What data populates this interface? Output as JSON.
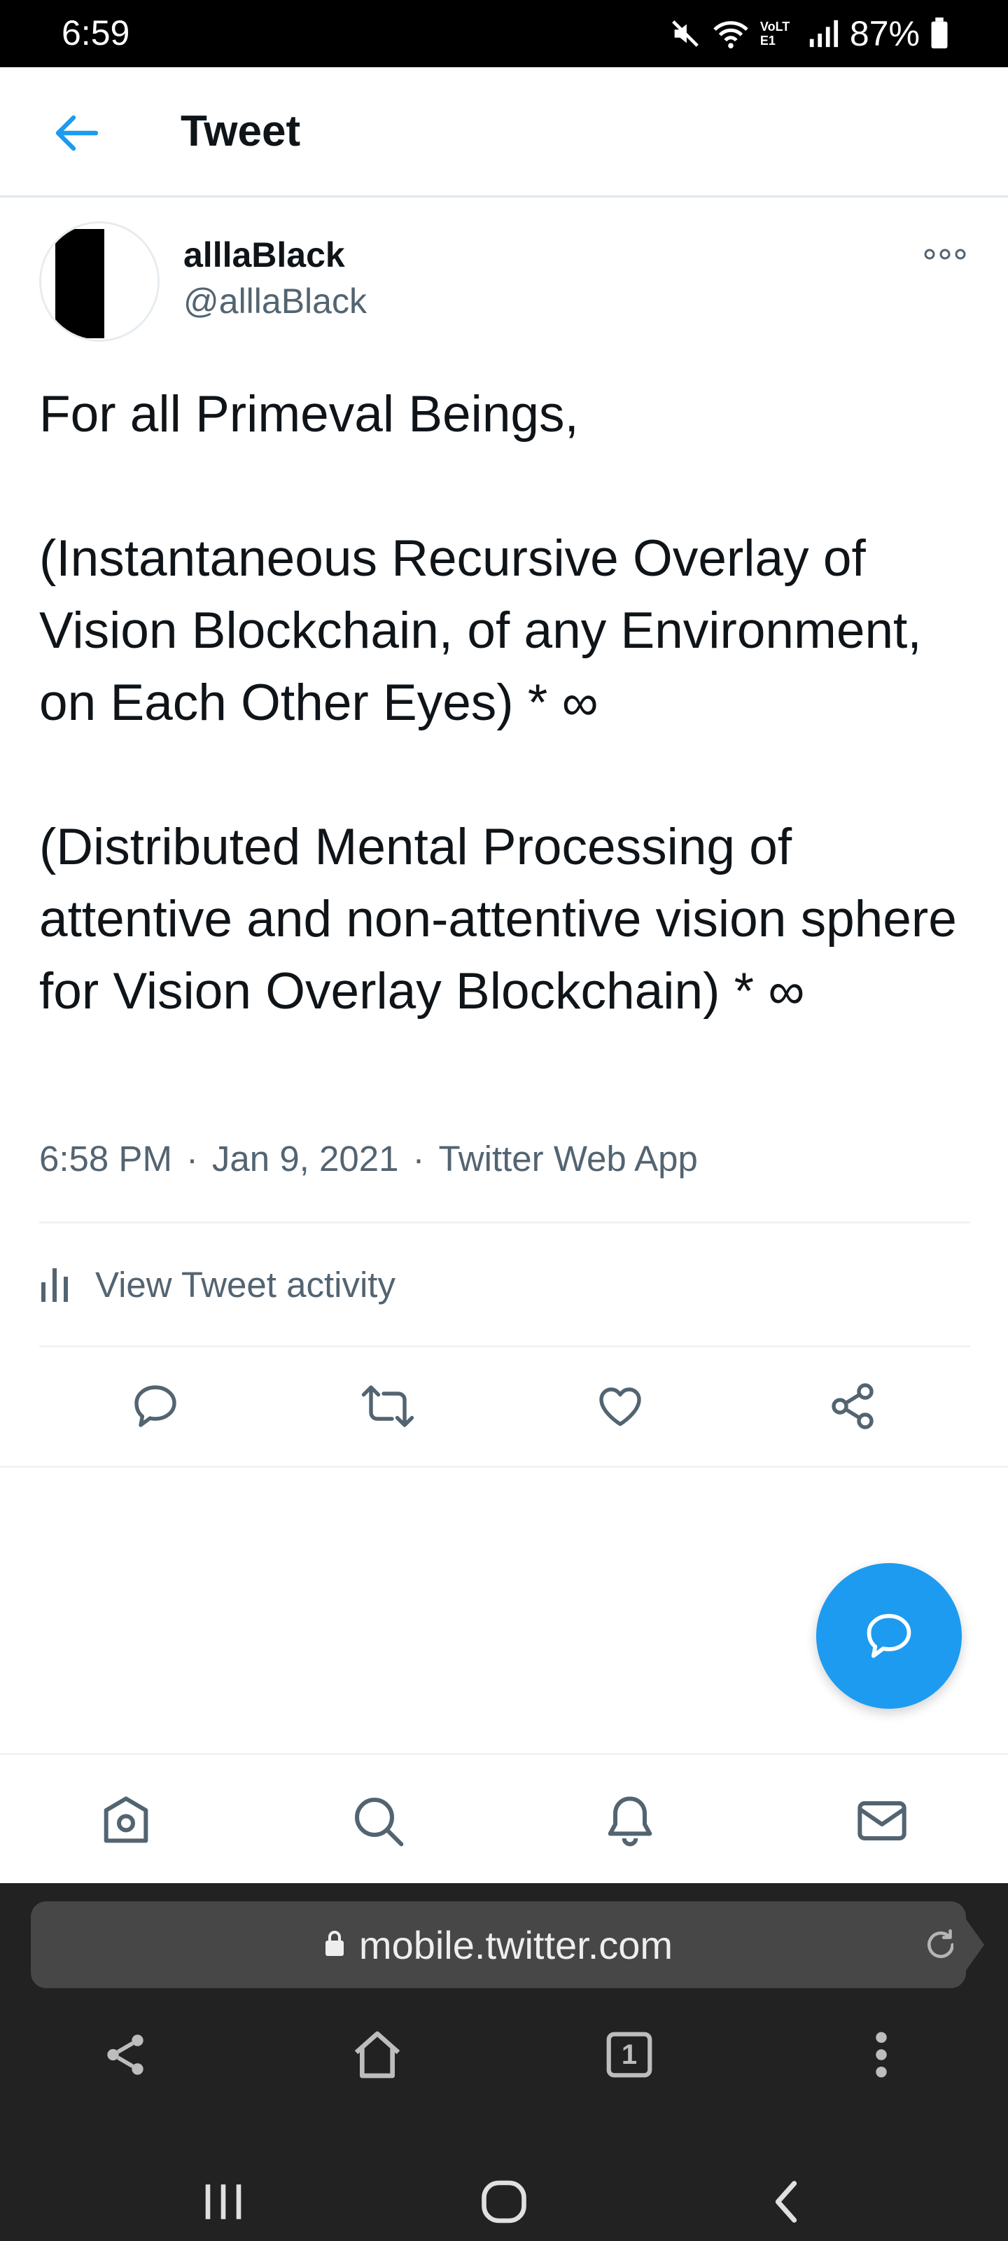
{
  "status_bar": {
    "time": "6:59",
    "network_label": "VoLTE1",
    "battery": "87%"
  },
  "header": {
    "title": "Tweet",
    "back_icon": "arrow-left-icon"
  },
  "tweet": {
    "display_name": "alllaBlack",
    "handle": "@alllaBlack",
    "text": "For all Primeval Beings,\n\n(Instantaneous Recursive Overlay of Vision Blockchain, of any Environment, on Each Other Eyes) * ∞\n\n(Distributed Mental Processing of attentive and non-attentive vision sphere for Vision Overlay Blockchain) * ∞",
    "time": "6:58 PM",
    "sep1": "·",
    "date": "Jan 9, 2021",
    "sep2": "·",
    "source": "Twitter Web App",
    "activity_label": "View Tweet activity",
    "actions": [
      "reply-icon",
      "retweet-icon",
      "like-icon",
      "share-icon"
    ]
  },
  "bottom_tabs": [
    "home-icon",
    "search-icon",
    "notifications-icon",
    "messages-icon"
  ],
  "browser": {
    "url": "mobile.twitter.com",
    "tab_count": "1"
  },
  "colors": {
    "accent": "#1d9bf0",
    "secondary_text": "#536471",
    "browser_bg": "#222222"
  }
}
